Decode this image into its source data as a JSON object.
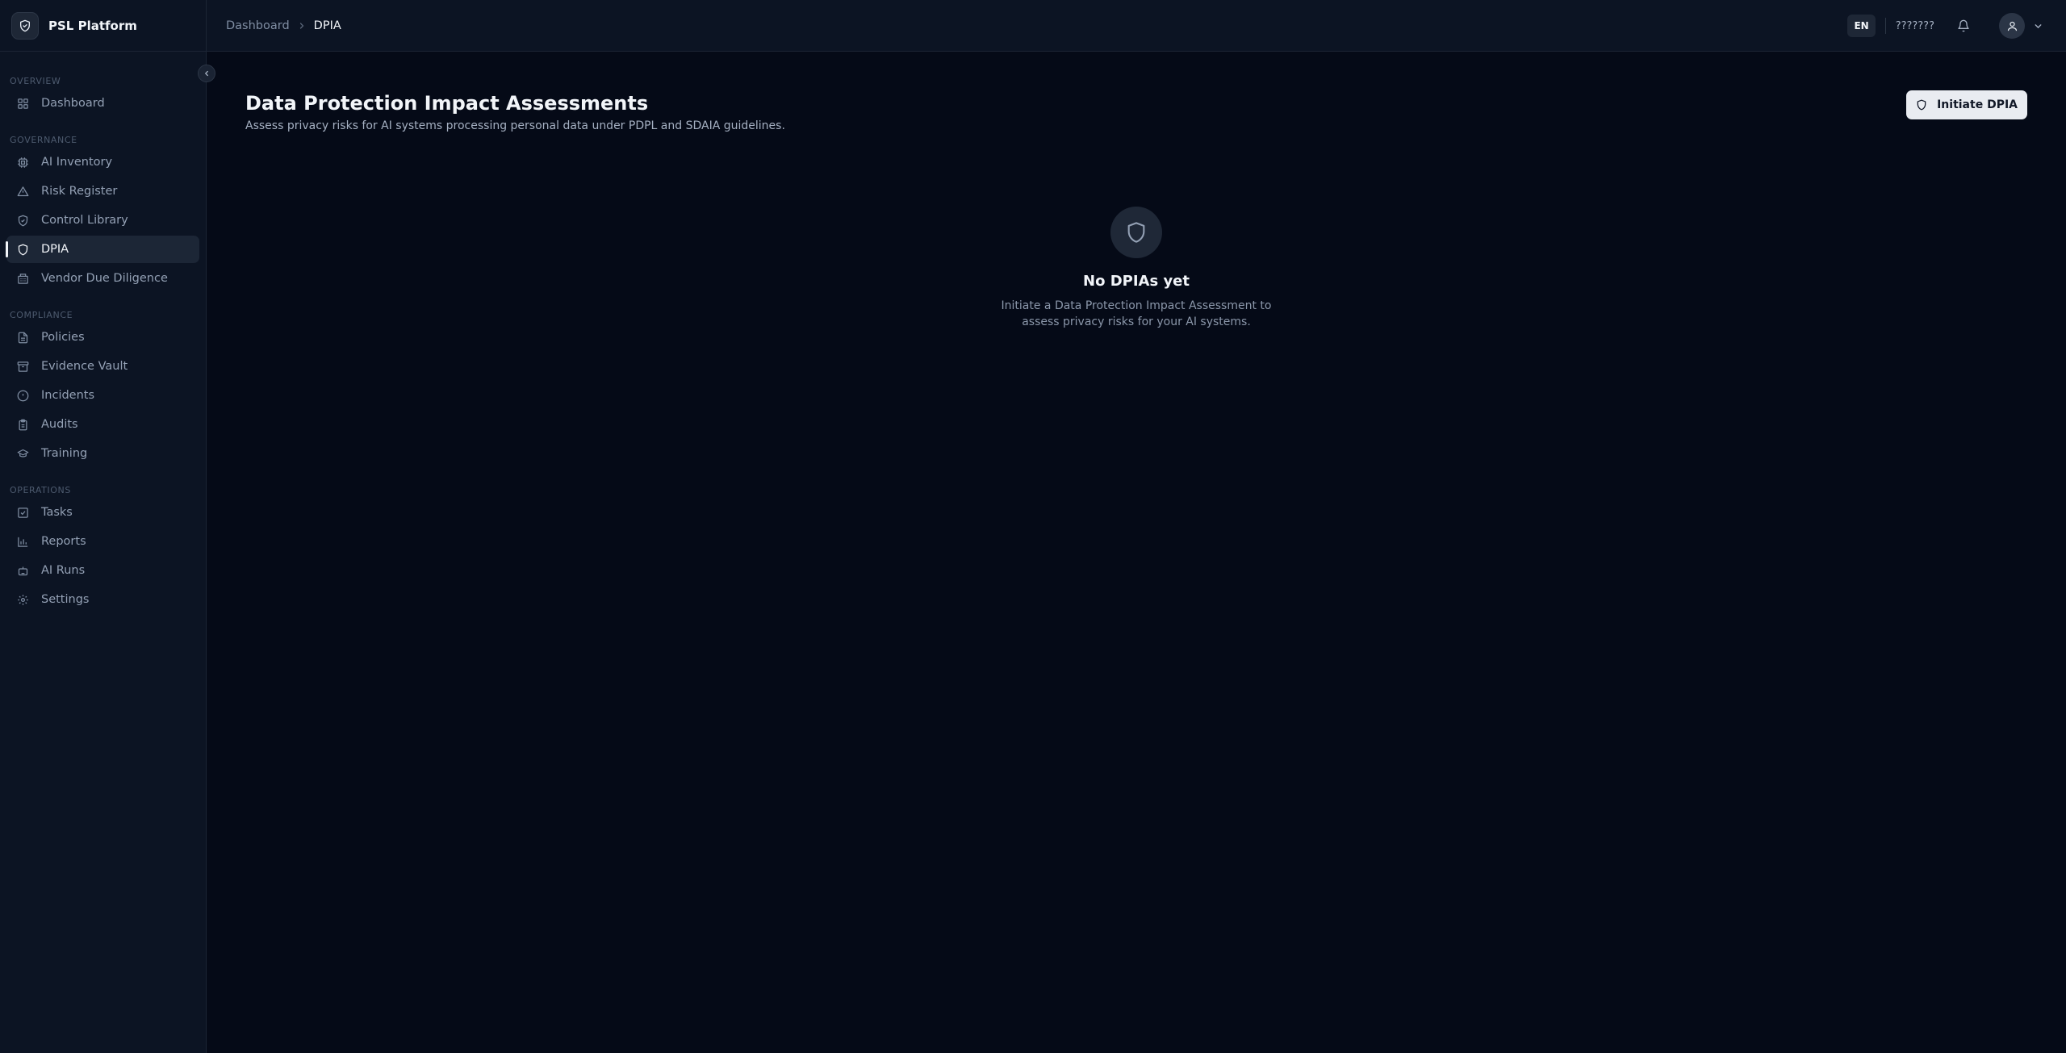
{
  "brand": {
    "name": "PSL Platform",
    "icon": "shield-logo-icon"
  },
  "sidebar": {
    "sections": [
      {
        "label": "OVERVIEW",
        "items": [
          {
            "label": "Dashboard",
            "icon": "grid-icon"
          }
        ]
      },
      {
        "label": "GOVERNANCE",
        "items": [
          {
            "label": "AI Inventory",
            "icon": "cpu-icon"
          },
          {
            "label": "Risk Register",
            "icon": "warning-triangle-icon"
          },
          {
            "label": "Control Library",
            "icon": "shield-check-icon"
          },
          {
            "label": "DPIA",
            "icon": "shield-icon",
            "active": true
          },
          {
            "label": "Vendor Due Diligence",
            "icon": "building-icon"
          }
        ]
      },
      {
        "label": "COMPLIANCE",
        "items": [
          {
            "label": "Policies",
            "icon": "document-icon"
          },
          {
            "label": "Evidence Vault",
            "icon": "archive-icon"
          },
          {
            "label": "Incidents",
            "icon": "alert-circle-icon"
          },
          {
            "label": "Audits",
            "icon": "clipboard-icon"
          },
          {
            "label": "Training",
            "icon": "graduation-cap-icon"
          }
        ]
      },
      {
        "label": "OPERATIONS",
        "items": [
          {
            "label": "Tasks",
            "icon": "checkbox-icon"
          },
          {
            "label": "Reports",
            "icon": "bar-chart-icon"
          },
          {
            "label": "AI Runs",
            "icon": "robot-icon"
          },
          {
            "label": "Settings",
            "icon": "gear-icon"
          }
        ]
      }
    ]
  },
  "header": {
    "breadcrumb": {
      "parent": "Dashboard",
      "current": "DPIA"
    },
    "language": "EN",
    "alt_language": "???????"
  },
  "main": {
    "title": "Data Protection Impact Assessments",
    "subtitle": "Assess privacy risks for AI systems processing personal data under PDPL and SDAIA guidelines.",
    "primary_button": "Initiate DPIA",
    "empty_state": {
      "title": "No DPIAs yet",
      "description": "Initiate a Data Protection Impact Assessment to assess privacy risks for your AI systems."
    }
  },
  "colors": {
    "background": "#050a17",
    "sidebar": "#0c1423",
    "active_item": "#1c2636",
    "primary_button": "#e9ecf1"
  }
}
